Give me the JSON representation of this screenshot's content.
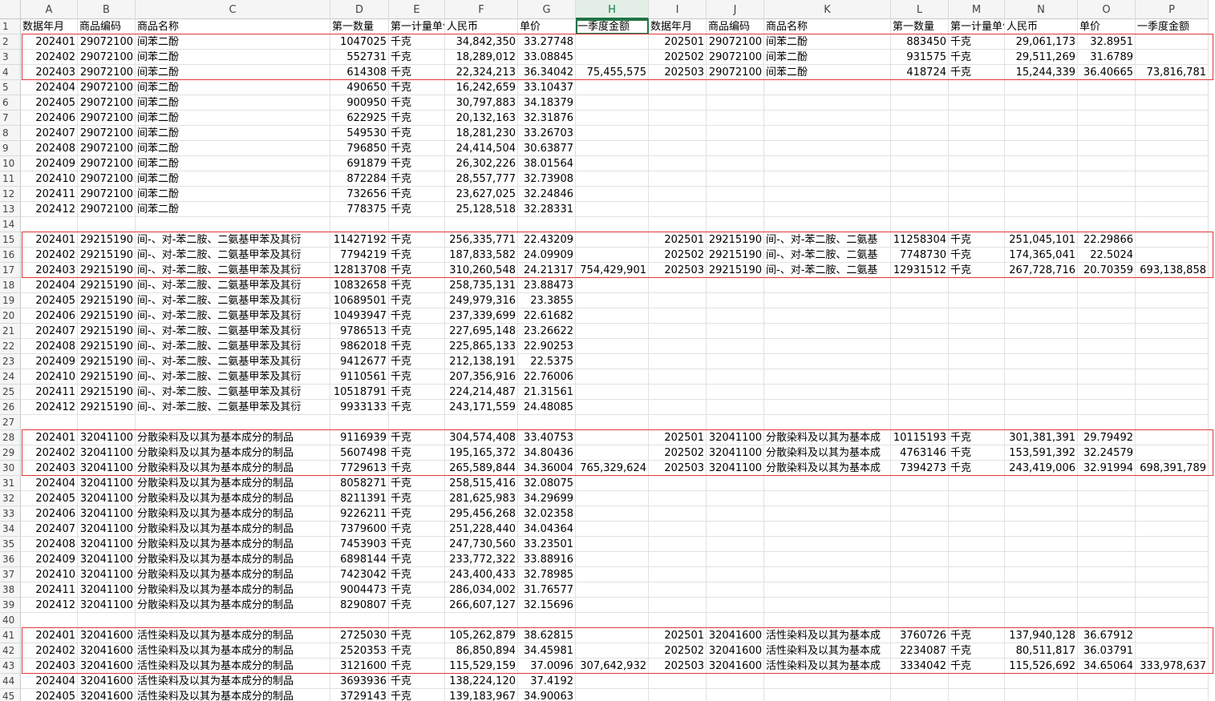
{
  "columns": [
    "A",
    "B",
    "C",
    "D",
    "E",
    "F",
    "G",
    "H",
    "I",
    "J",
    "K",
    "L",
    "M",
    "N",
    "O",
    "P"
  ],
  "selected_column": "H",
  "unit": "千克",
  "headers": [
    "数据年月",
    "商品编码",
    "商品名称",
    "第一数量",
    "第一计量单位",
    "人民币",
    "单价",
    "一季度金额",
    "数据年月",
    "商品编码",
    "商品名称",
    "第一数量",
    "第一计量单位",
    "人民币",
    "单价",
    "一季度金额"
  ],
  "groups": [
    {
      "code": "29072100",
      "name": "间苯二酚",
      "name_right": "间苯二酚",
      "q1_2024_total": "75,455,575",
      "q1_2025_total": "73,816,781",
      "rows_2024": [
        [
          "202401",
          "1047025",
          "34,842,350",
          "33.27748"
        ],
        [
          "202402",
          "552731",
          "18,289,012",
          "33.08845"
        ],
        [
          "202403",
          "614308",
          "22,324,213",
          "36.34042"
        ],
        [
          "202404",
          "490650",
          "16,242,659",
          "33.10437"
        ],
        [
          "202405",
          "900950",
          "30,797,883",
          "34.18379"
        ],
        [
          "202406",
          "622925",
          "20,132,163",
          "32.31876"
        ],
        [
          "202407",
          "549530",
          "18,281,230",
          "33.26703"
        ],
        [
          "202408",
          "796850",
          "24,414,504",
          "30.63877"
        ],
        [
          "202409",
          "691879",
          "26,302,226",
          "38.01564"
        ],
        [
          "202410",
          "872284",
          "28,557,777",
          "32.73908"
        ],
        [
          "202411",
          "732656",
          "23,627,025",
          "32.24846"
        ],
        [
          "202412",
          "778375",
          "25,128,518",
          "32.28331"
        ]
      ],
      "rows_2025": [
        [
          "202501",
          "883450",
          "29,061,173",
          "32.8951"
        ],
        [
          "202502",
          "931575",
          "29,511,269",
          "31.6789"
        ],
        [
          "202503",
          "418724",
          "15,244,339",
          "36.40665"
        ]
      ]
    },
    {
      "code": "29215190",
      "name": "间-、对-苯二胺、二氨基甲苯及其衍",
      "name_right": "间-、对-苯二胺、二氨基",
      "q1_2024_total": "754,429,901",
      "q1_2025_total": "693,138,858",
      "rows_2024": [
        [
          "202401",
          "11427192",
          "256,335,771",
          "22.43209"
        ],
        [
          "202402",
          "7794219",
          "187,833,582",
          "24.09909"
        ],
        [
          "202403",
          "12813708",
          "310,260,548",
          "24.21317"
        ],
        [
          "202404",
          "10832658",
          "258,735,131",
          "23.88473"
        ],
        [
          "202405",
          "10689501",
          "249,979,316",
          "23.3855"
        ],
        [
          "202406",
          "10493947",
          "237,339,699",
          "22.61682"
        ],
        [
          "202407",
          "9786513",
          "227,695,148",
          "23.26622"
        ],
        [
          "202408",
          "9862018",
          "225,865,133",
          "22.90253"
        ],
        [
          "202409",
          "9412677",
          "212,138,191",
          "22.5375"
        ],
        [
          "202410",
          "9110561",
          "207,356,916",
          "22.76006"
        ],
        [
          "202411",
          "10518791",
          "224,214,487",
          "21.31561"
        ],
        [
          "202412",
          "9933133",
          "243,171,559",
          "24.48085"
        ]
      ],
      "rows_2025": [
        [
          "202501",
          "11258304",
          "251,045,101",
          "22.29866"
        ],
        [
          "202502",
          "7748730",
          "174,365,041",
          "22.5024"
        ],
        [
          "202503",
          "12931512",
          "267,728,716",
          "20.70359"
        ]
      ]
    },
    {
      "code": "32041100",
      "name": "分散染料及以其为基本成分的制品",
      "name_right": "分散染料及以其为基本成",
      "q1_2024_total": "765,329,624",
      "q1_2025_total": "698,391,789",
      "rows_2024": [
        [
          "202401",
          "9116939",
          "304,574,408",
          "33.40753"
        ],
        [
          "202402",
          "5607498",
          "195,165,372",
          "34.80436"
        ],
        [
          "202403",
          "7729613",
          "265,589,844",
          "34.36004"
        ],
        [
          "202404",
          "8058271",
          "258,515,416",
          "32.08075"
        ],
        [
          "202405",
          "8211391",
          "281,625,983",
          "34.29699"
        ],
        [
          "202406",
          "9226211",
          "295,456,268",
          "32.02358"
        ],
        [
          "202407",
          "7379600",
          "251,228,440",
          "34.04364"
        ],
        [
          "202408",
          "7453903",
          "247,730,560",
          "33.23501"
        ],
        [
          "202409",
          "6898144",
          "233,772,322",
          "33.88916"
        ],
        [
          "202410",
          "7423042",
          "243,400,433",
          "32.78985"
        ],
        [
          "202411",
          "9004473",
          "286,034,002",
          "31.76577"
        ],
        [
          "202412",
          "8290807",
          "266,607,127",
          "32.15696"
        ]
      ],
      "rows_2025": [
        [
          "202501",
          "10115193",
          "301,381,391",
          "29.79492"
        ],
        [
          "202502",
          "4763146",
          "153,591,392",
          "32.24579"
        ],
        [
          "202503",
          "7394273",
          "243,419,006",
          "32.91994"
        ]
      ]
    },
    {
      "code": "32041600",
      "name": "活性染料及以其为基本成分的制品",
      "name_right": "活性染料及以其为基本成",
      "q1_2024_total": "307,642,932",
      "q1_2025_total": "333,978,637",
      "rows_2024": [
        [
          "202401",
          "2725030",
          "105,262,879",
          "38.62815"
        ],
        [
          "202402",
          "2520353",
          "86,850,894",
          "34.45981"
        ],
        [
          "202403",
          "3121600",
          "115,529,159",
          "37.0096"
        ],
        [
          "202404",
          "3693936",
          "138,224,120",
          "37.4192"
        ],
        [
          "202405",
          "3729143",
          "139,183,967",
          "34.90063"
        ]
      ],
      "rows_2025": [
        [
          "202501",
          "3760726",
          "137,940,128",
          "36.67912"
        ],
        [
          "202502",
          "2234087",
          "80,511,817",
          "36.03791"
        ],
        [
          "202503",
          "3334042",
          "115,526,692",
          "34.65064"
        ]
      ]
    }
  ]
}
